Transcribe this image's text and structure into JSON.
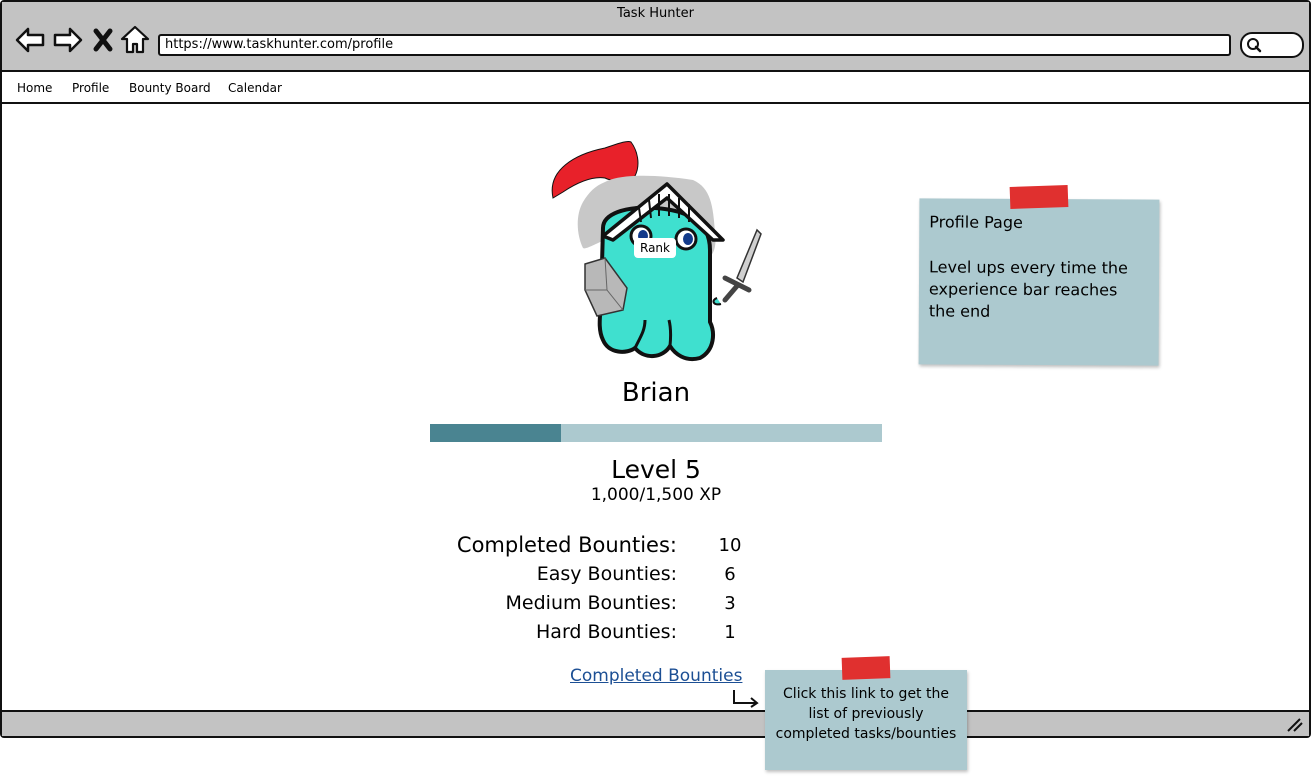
{
  "window": {
    "title": "Task Hunter"
  },
  "toolbar": {
    "back_icon": "back-arrow-icon",
    "forward_icon": "forward-arrow-icon",
    "stop_icon": "close-icon",
    "home_icon": "home-icon",
    "url": "https://www.taskhunter.com/profile",
    "search_icon": "search-icon"
  },
  "menu": {
    "items": [
      {
        "label": "Home"
      },
      {
        "label": "Profile"
      },
      {
        "label": "Bounty Board"
      },
      {
        "label": "Calendar"
      }
    ]
  },
  "profile": {
    "rank_label": "Rank",
    "name": "Brian",
    "level": "Level 5",
    "xp": "1,000/1,500 XP",
    "xp_fraction": 0.29,
    "stats": [
      {
        "label": "Completed Bounties:",
        "value": "10"
      },
      {
        "label": "Easy Bounties:",
        "value": "6"
      },
      {
        "label": "Medium Bounties:",
        "value": "3"
      },
      {
        "label": "Hard Bounties:",
        "value": "1"
      }
    ],
    "completed_link": "Completed Bounties"
  },
  "notes": {
    "profile": {
      "title": "Profile Page",
      "body": "Level ups every time the experience bar reaches the end"
    },
    "link": {
      "body": "Click this link to get the list of previously completed tasks/bounties"
    }
  },
  "colors": {
    "window_chrome": "#c3c3c3",
    "xp_fill": "#4a8491",
    "xp_track": "#acc9cf",
    "note": "#acc9cf",
    "tape": "#e0302f",
    "link": "#1c4f94",
    "avatar_body": "#3fe0cf"
  }
}
